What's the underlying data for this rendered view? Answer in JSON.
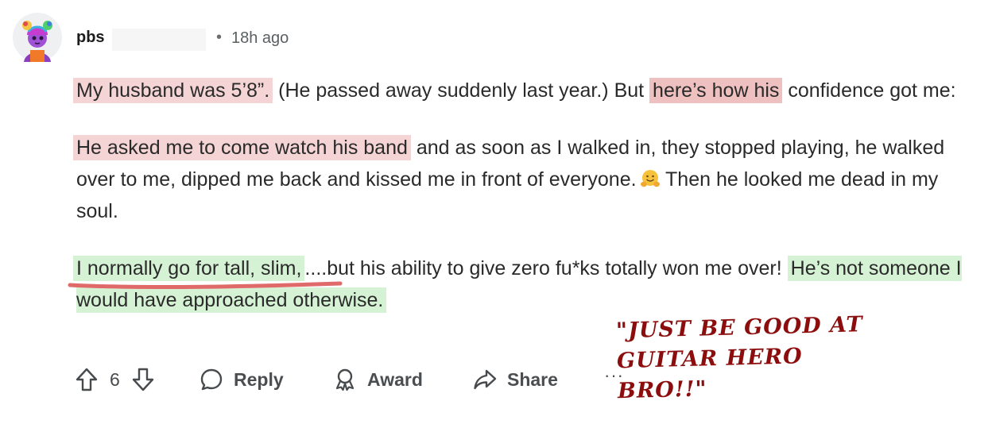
{
  "comment": {
    "username": "pbs",
    "separator": "•",
    "time_ago": "18h ago",
    "paragraphs": {
      "p1": {
        "highlight1": "My husband was 5’8”.",
        "text1": " (He passed away suddenly last year.) But ",
        "highlight2": "here’s how his",
        "text2": " confidence got me:"
      },
      "p2": {
        "highlight1": "He asked me to come watch his band",
        "text1": " and as soon as I walked in, they stopped playing, he walked over to me, dipped me back and kissed me in front of everyone.",
        "text2": " Then he looked me dead in my soul."
      },
      "p3": {
        "highlight1": "I normally go for tall, slim,",
        "text1": "....but his ability to give zero fu*ks totally won me over! ",
        "highlight2": "He’s not someone I would have approached otherwise."
      }
    },
    "emoji": "hugging-face-emoji",
    "annotation": {
      "line1": "\"JUST BE GOOD AT",
      "line2": "GUITAR HERO BRO!!\"",
      "color": "#8b0d0d"
    },
    "actions": {
      "vote_count": "6",
      "reply_label": "Reply",
      "award_label": "Award",
      "share_label": "Share",
      "more_label": "···"
    },
    "colors": {
      "highlight_red": "#f4d4d4",
      "highlight_green": "#d6f2d5",
      "underline": "#e06a6a"
    }
  }
}
